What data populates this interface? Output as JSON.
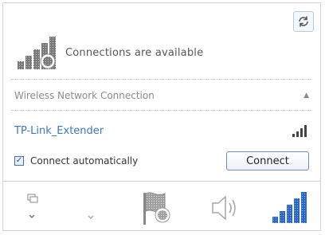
{
  "status": {
    "text": "Connections are available"
  },
  "section": {
    "title": "Wireless Network Connection",
    "collapse_glyph": "▲"
  },
  "network": {
    "name": "TP-Link_Extender",
    "auto_connect_label": "Connect automatically",
    "auto_connect_checked": true,
    "checkbox_glyph": "✓",
    "connect_label": "Connect"
  },
  "tray": {
    "icons": [
      "show-hidden-icons",
      "action-center-flag-icon",
      "volume-icon",
      "wifi-signal-icon"
    ]
  },
  "colors": {
    "network_name": "#3a76c4",
    "wifi_tray": "#2a67c9"
  }
}
